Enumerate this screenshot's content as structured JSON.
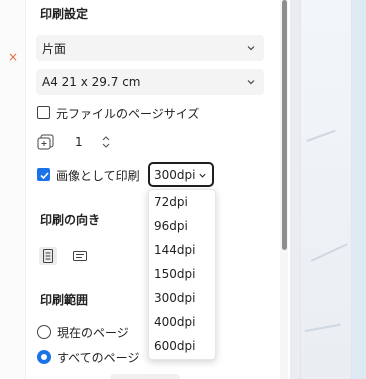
{
  "sections": {
    "print_settings_title": "印刷設定",
    "orientation_title": "印刷の向き",
    "range_title": "印刷範囲"
  },
  "sides_select": {
    "value": "片面"
  },
  "paper_select": {
    "value": "A4 21 x 29.7 cm"
  },
  "original_size_checkbox": {
    "label": "元ファイルのページサイズ",
    "checked": false
  },
  "copies": {
    "value": "1"
  },
  "image_print_checkbox": {
    "label": "画像として印刷",
    "checked": true
  },
  "dpi_select": {
    "value": "300dpi",
    "options": [
      "72dpi",
      "96dpi",
      "144dpi",
      "150dpi",
      "300dpi",
      "400dpi",
      "600dpi"
    ]
  },
  "orientation": {
    "selected": "portrait"
  },
  "range": {
    "current_page_label": "現在のページ",
    "all_pages_label": "すべてのページ",
    "selected": "all_pages"
  },
  "colors": {
    "accent": "#1a73e8",
    "preview_bg": "#e9edf2",
    "scrollbar_thumb": "#8e8e8e"
  },
  "icons": {
    "chevron": "chevron-down-icon",
    "copies": "copies-icon",
    "stepper": "stepper-arrows-icon",
    "portrait": "portrait-orientation-icon",
    "landscape": "landscape-orientation-icon"
  }
}
